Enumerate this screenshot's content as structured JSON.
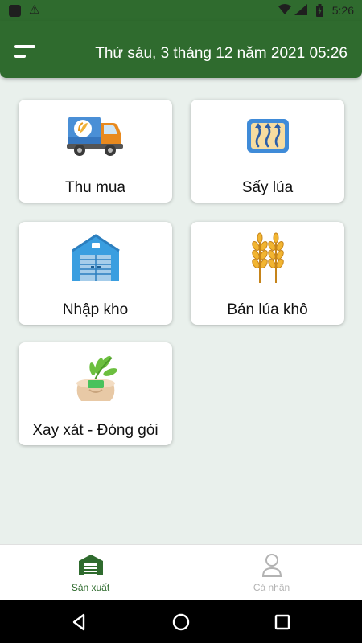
{
  "status_bar": {
    "time": "5:26",
    "icons": [
      "app-notification-icon",
      "warning-icon",
      "wifi-icon",
      "signal-icon",
      "battery-icon"
    ]
  },
  "header": {
    "menu_icon": "menu-icon",
    "date_text": "Thứ sáu, 3 tháng 12 năm 2021 05:26",
    "color": "#2f6b2e"
  },
  "menu": {
    "items": [
      {
        "label": "Thu mua",
        "icon": "truck-icon"
      },
      {
        "label": "Sấy lúa",
        "icon": "heat-dryer-icon"
      },
      {
        "label": "Nhập kho",
        "icon": "warehouse-icon"
      },
      {
        "label": "Bán lúa khô",
        "icon": "rice-stalks-icon"
      },
      {
        "label": "Xay xát - Đóng gói",
        "icon": "rice-sack-icon"
      }
    ]
  },
  "bottom_nav": {
    "items": [
      {
        "label": "Sản xuất",
        "icon": "warehouse-nav-icon",
        "active": true
      },
      {
        "label": "Cá nhân",
        "icon": "person-icon",
        "active": false
      }
    ],
    "active_color": "#2f6b2e",
    "inactive_color": "#b3b3b3"
  },
  "system_nav": {
    "icons": [
      "back-icon",
      "home-icon",
      "recents-icon"
    ]
  }
}
